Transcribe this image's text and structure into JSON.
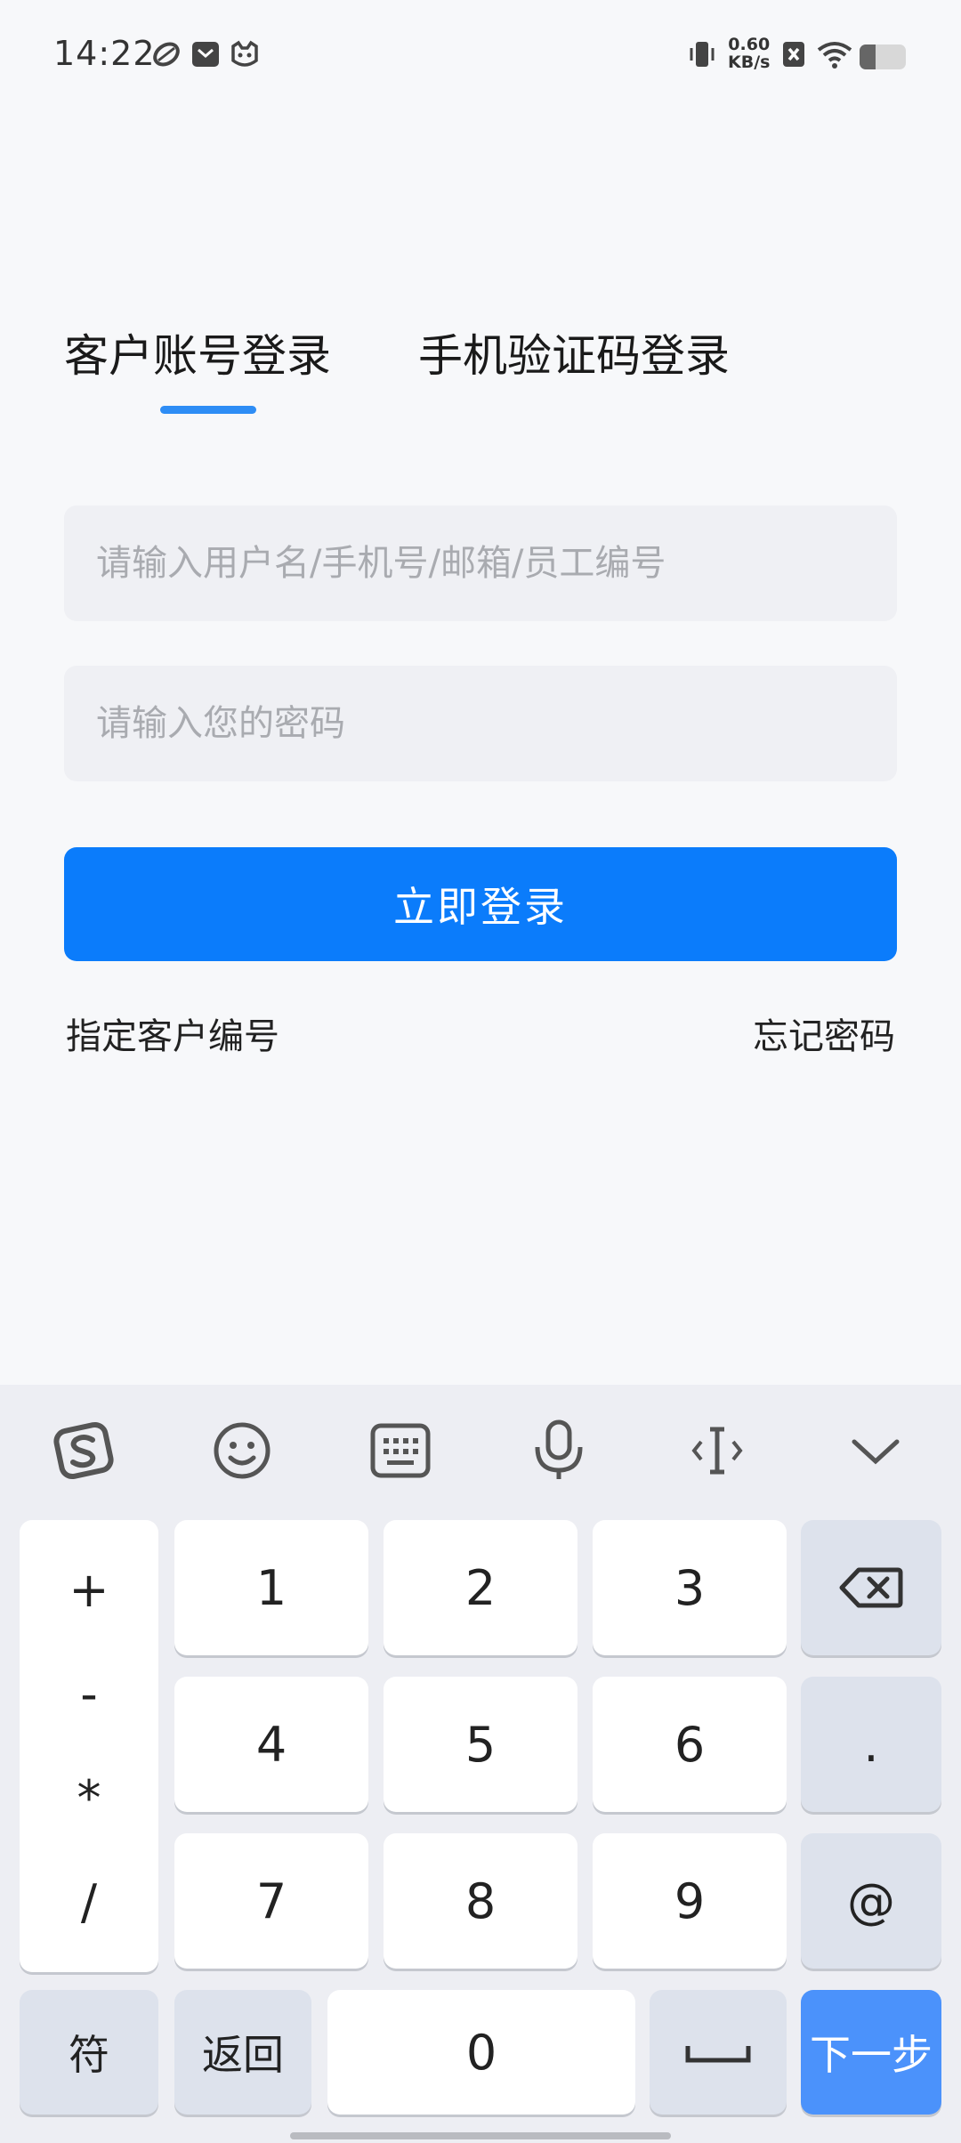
{
  "status_bar": {
    "time": "14:22",
    "net_speed_value": "0.60",
    "net_speed_unit": "KB/s",
    "battery_level": 0.35
  },
  "tabs": [
    {
      "label": "客户账号登录",
      "active": true
    },
    {
      "label": "手机验证码登录",
      "active": false
    }
  ],
  "form": {
    "username_placeholder": "请输入用户名/手机号/邮箱/员工编号",
    "username_value": "",
    "password_placeholder": "请输入您的密码",
    "password_value": "",
    "login_label": "立即登录",
    "specify_customer_label": "指定客户编号",
    "forgot_password_label": "忘记密码"
  },
  "keyboard": {
    "toolbar_icons": [
      "sogou-logo-icon",
      "emoji-icon",
      "keyboard-icon",
      "microphone-icon",
      "cursor-icon",
      "collapse-icon"
    ],
    "symbols": [
      "+",
      "-",
      "*",
      "/"
    ],
    "digits": [
      "1",
      "2",
      "3",
      "4",
      "5",
      "6",
      "7",
      "8",
      "9",
      "0"
    ],
    "dot": ".",
    "at": "@",
    "symbol_key": "符",
    "back_key": "返回",
    "next_key": "下一步"
  },
  "colors": {
    "accent": "#0b7cfb",
    "tab_indicator": "#2e8df5",
    "next_key": "#4b92fb"
  }
}
